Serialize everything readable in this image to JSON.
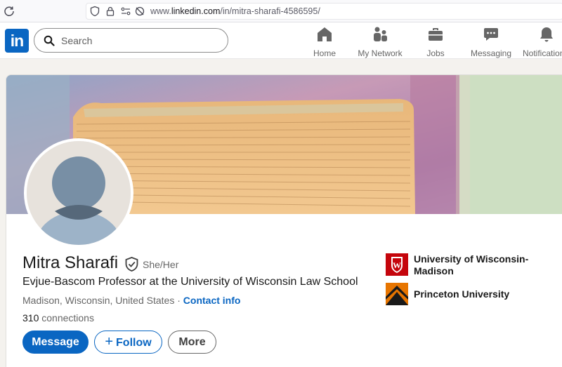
{
  "browser": {
    "url_prefix": "www.",
    "url_domain": "linkedin.com",
    "url_path": "/in/mitra-sharafi-4586595/"
  },
  "nav": {
    "logo": "in",
    "search_placeholder": "Search",
    "items": [
      {
        "label": "Home",
        "icon": "home-icon"
      },
      {
        "label": "My Network",
        "icon": "network-icon"
      },
      {
        "label": "Jobs",
        "icon": "briefcase-icon"
      },
      {
        "label": "Messaging",
        "icon": "message-icon"
      },
      {
        "label": "Notifications",
        "icon": "bell-icon"
      }
    ]
  },
  "profile": {
    "name": "Mitra Sharafi",
    "pronouns": "She/Her",
    "headline": "Evjue-Bascom Professor at the University of Wisconsin Law School",
    "location": "Madison, Wisconsin, United States",
    "separator": "·",
    "contact_label": "Contact info",
    "connections_count": "310",
    "connections_label": "connections"
  },
  "actions": {
    "message": "Message",
    "follow": "Follow",
    "more": "More"
  },
  "education": [
    {
      "name": "University of Wisconsin-Madison",
      "icon": "uw-crest-icon"
    },
    {
      "name": "Princeton University",
      "icon": "princeton-shield-icon"
    }
  ],
  "colors": {
    "brand": "#0a66c2",
    "uw_red": "#c5050c",
    "princeton_orange": "#e77500"
  }
}
